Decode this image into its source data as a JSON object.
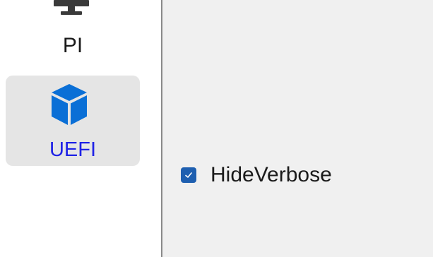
{
  "sidebar": {
    "items": [
      {
        "label": "PI",
        "icon": "monitor-icon",
        "selected": false
      },
      {
        "label": "UEFI",
        "icon": "cube-icon",
        "selected": true
      }
    ]
  },
  "main": {
    "options": [
      {
        "label": "HideVerbose",
        "checked": true
      }
    ]
  },
  "colors": {
    "accent": "#0a6fd6",
    "selected_label": "#1f22e6",
    "selected_bg": "#e5e5e5",
    "checkbox": "#1e5fb0"
  }
}
